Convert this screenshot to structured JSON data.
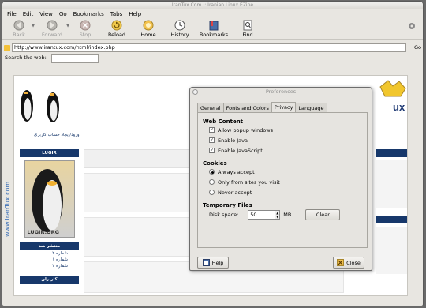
{
  "window": {
    "title": "IranTux.Com :: Iranian Linux EZine"
  },
  "menu": [
    {
      "label": "File"
    },
    {
      "label": "Edit"
    },
    {
      "label": "View"
    },
    {
      "label": "Go"
    },
    {
      "label": "Bookmarks"
    },
    {
      "label": "Tabs"
    },
    {
      "label": "Help"
    }
  ],
  "toolbar": {
    "back": "Back",
    "forward": "Forward",
    "stop": "Stop",
    "reload": "Reload",
    "home": "Home",
    "history": "History",
    "bookmarks": "Bookmarks",
    "find": "Find"
  },
  "address": {
    "url": "http://www.irantux.com/html/index.php",
    "go": "Go"
  },
  "search": {
    "label": "Search the web:",
    "value": ""
  },
  "site": {
    "box1_title": "LUGIR",
    "poster_text": "LUGIR.ORG",
    "box2_title": "منتشر شد",
    "issues": [
      "شماره ۲",
      "شماره ۱",
      "شماره ۲"
    ],
    "box3_title": "کاربران"
  },
  "dialog": {
    "title": "Preferences",
    "tabs": [
      {
        "label": "General"
      },
      {
        "label": "Fonts and Colors"
      },
      {
        "label": "Privacy"
      },
      {
        "label": "Language"
      }
    ],
    "web_content": {
      "heading": "Web Content",
      "options": [
        {
          "label": "Allow popup windows",
          "checked": true
        },
        {
          "label": "Enable Java",
          "checked": true
        },
        {
          "label": "Enable JavaScript",
          "checked": true
        }
      ]
    },
    "cookies": {
      "heading": "Cookies",
      "options": [
        {
          "label": "Always accept",
          "selected": true
        },
        {
          "label": "Only from sites you visit",
          "selected": false
        },
        {
          "label": "Never accept",
          "selected": false
        }
      ]
    },
    "temp_files": {
      "heading": "Temporary Files",
      "disk_label": "Disk space:",
      "disk_value": "50",
      "unit": "MB",
      "clear": "Clear"
    },
    "help": "Help",
    "close": "Close"
  },
  "watermark": "www.IranTux.com"
}
